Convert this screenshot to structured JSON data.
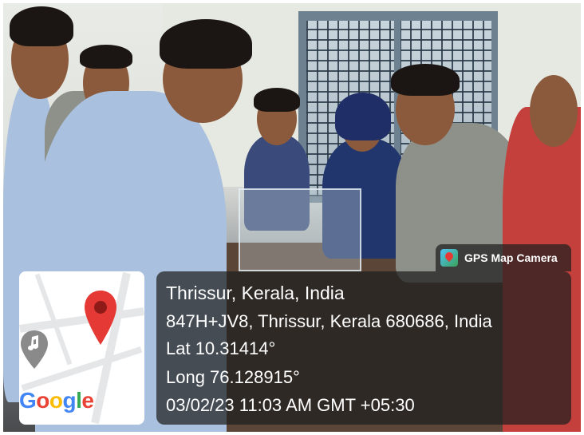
{
  "badge": {
    "app_name": "GPS Map Camera",
    "icon": "gps-map-camera-icon"
  },
  "location": {
    "title": "Thrissur, Kerala, India",
    "address": "847H+JV8, Thrissur, Kerala 680686, India",
    "latitude": "Lat 10.31414°",
    "longitude": "Long 76.128915°",
    "datetime": "03/02/23 11:03 AM GMT +05:30"
  },
  "map": {
    "logo_text": "Google",
    "pin_icon": "map-pin-icon",
    "poi_icon": "music-note-pin-icon",
    "colors": {
      "pin": "#e53935",
      "poi": "#8a8a8a",
      "google_blue": "#4285F4",
      "google_red": "#EA4335",
      "google_yellow": "#FBBC05",
      "google_green": "#34A853"
    }
  },
  "overlay": {
    "panel_color": "rgba(30,30,30,0.72)",
    "text_color": "#ffffff"
  }
}
